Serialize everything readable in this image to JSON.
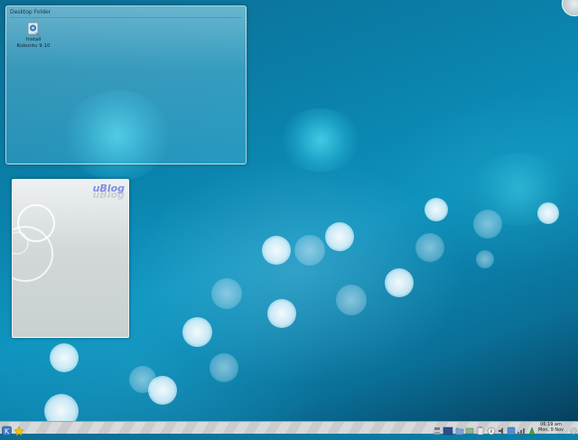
{
  "folder": {
    "title": "Desktop Folder",
    "items": [
      {
        "label": "Install Kubuntu 9.10",
        "icon": "installer-icon"
      }
    ]
  },
  "ublog": {
    "logo": "uBlog"
  },
  "taskbar": {
    "clock_time": "06:19 am",
    "clock_date": "Mon, 9 Nov",
    "icons": [
      "kickoff-menu-icon",
      "folder-view-icon",
      "display-icon",
      "file-manager-icon",
      "network-icon",
      "clipboard-icon",
      "info-icon",
      "volume-icon",
      "update-notifier-icon",
      "network-manager-icon",
      "power-icon"
    ]
  },
  "colors": {
    "background": "#0a7fa8",
    "panel": "#d0d2d3",
    "widget_accent": "#7f8fe0"
  }
}
